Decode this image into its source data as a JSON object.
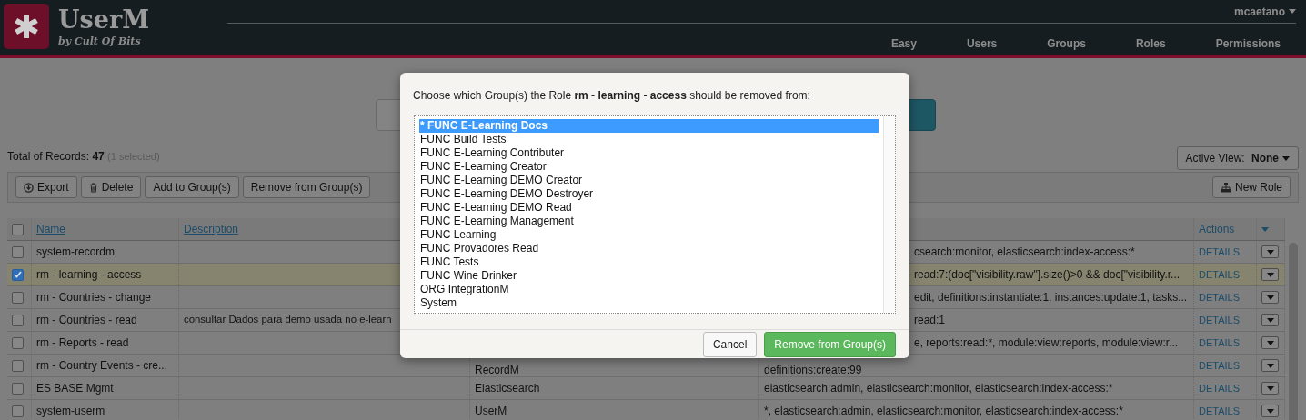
{
  "navbar": {
    "logo": {
      "title": "UserM",
      "subtitle": "by Cult Of Bits"
    },
    "user_menu": "mcaetano",
    "links": [
      "Easy",
      "Users",
      "Groups",
      "Roles",
      "Permissions"
    ]
  },
  "summary": {
    "label": "Total of Records:",
    "total": "47",
    "selected_note": "(1 selected)"
  },
  "active_view": {
    "label": "Active View:",
    "value": "None"
  },
  "toolbar": {
    "buttons": [
      {
        "kind": "export",
        "label": "Export"
      },
      {
        "kind": "delete",
        "label": "Delete"
      },
      {
        "kind": "plain",
        "label": "Add to Group(s)"
      },
      {
        "kind": "plain",
        "label": "Remove from Group(s)"
      }
    ],
    "new_button": "New Role"
  },
  "table": {
    "select_all": {
      "checked": false
    },
    "columns": [
      "Name",
      "Description",
      "Actions"
    ],
    "rows": [
      {
        "name": "system-recordm",
        "column_4": "csearch:monitor, elasticsearch:index-access:*",
        "action": "DETAILS",
        "selected": false
      },
      {
        "name": "rm - learning - access",
        "column_4": "read:7:(doc[\"visibility.raw\"].size()>0 && doc[\"visibility.r...",
        "action": "DETAILS",
        "selected": true
      },
      {
        "name": "rm - Countries - change",
        "column_4": "edit, definitions:instantiate:1, instances:update:1, tasks...",
        "action": "DETAILS",
        "selected": false
      },
      {
        "name": "rm - Countries - read",
        "description": "consultar Dados para demo usada no e-learn",
        "column_4": "read:1",
        "action": "DETAILS",
        "selected": false
      },
      {
        "name": "rm - Reports - read",
        "column_4": "e, reports:read:*, module:view:reports, module:view:r...",
        "action": "DETAILS",
        "selected": false
      },
      {
        "name": "rm - Country Events - cre...",
        "column_3": "RecordM",
        "column_4": "definitions:create:99",
        "action": "DETAILS",
        "selected": false
      },
      {
        "name": "ES BASE Mgmt",
        "column_3": "Elasticsearch",
        "column_4": "elasticsearch:admin, elasticsearch:monitor, elasticsearch:index-access:*",
        "action": "DETAILS",
        "selected": false
      },
      {
        "name": "system-userm",
        "column_3": "UserM",
        "column_4": "*, elasticsearch:admin, elasticsearch:monitor, elasticsearch:index-access:*",
        "action": "DETAILS",
        "selected": false
      }
    ]
  },
  "dialog": {
    "message": "Choose which Group(s) the Role **rm - learning - access** should be removed from:",
    "groups": [
      {
        "label": "* FUNC E-Learning Docs",
        "selected": true
      },
      {
        "label": "FUNC Build Tests",
        "selected": false
      },
      {
        "label": "FUNC E-Learning Contributer",
        "selected": false
      },
      {
        "label": "FUNC E-Learning Creator",
        "selected": false
      },
      {
        "label": "FUNC E-Learning DEMO Creator",
        "selected": false
      },
      {
        "label": "FUNC E-Learning DEMO Destroyer",
        "selected": false
      },
      {
        "label": "FUNC E-Learning DEMO Read",
        "selected": false
      },
      {
        "label": "FUNC E-Learning Management",
        "selected": false
      },
      {
        "label": "FUNC Learning",
        "selected": false
      },
      {
        "label": "FUNC Provadores Read",
        "selected": false
      },
      {
        "label": "FUNC Tests",
        "selected": false
      },
      {
        "label": "FUNC Wine Drinker",
        "selected": false
      },
      {
        "label": "ORG IntegrationM",
        "selected": false
      },
      {
        "label": "System",
        "selected": false
      }
    ],
    "buttons": [
      {
        "kind": "cancel",
        "label": "Cancel"
      },
      {
        "kind": "confirm",
        "label": "Remove from Group(s)"
      }
    ]
  }
}
